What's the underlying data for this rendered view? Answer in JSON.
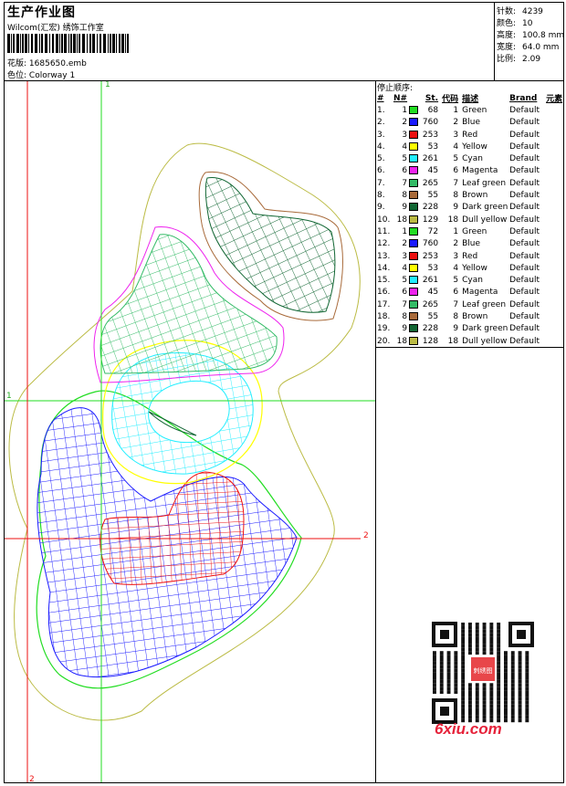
{
  "header": {
    "title": "生产作业图",
    "subtitle": "Wilcom(汇宏) 绣饰工作室",
    "file_label": "花版:",
    "file_value": "1685650.emb",
    "colorway_label": "色位:",
    "colorway_value": "Colorway 1"
  },
  "stats": [
    {
      "label": "针数:",
      "value": "4239"
    },
    {
      "label": "颜色:",
      "value": "10"
    },
    {
      "label": "高度:",
      "value": "100.8 mm"
    },
    {
      "label": "宽度:",
      "value": "64.0 mm"
    },
    {
      "label": "比例:",
      "value": "2.09"
    }
  ],
  "sequence": {
    "title": "停止顺序:",
    "columns": [
      "#",
      "N#",
      "St.",
      "代码",
      "描述",
      "Brand",
      "元素"
    ],
    "rows": [
      {
        "idx": "1.",
        "n": "1",
        "color": "#22dd22",
        "st": "68",
        "code": "1",
        "desc": "Green",
        "brand": "Default"
      },
      {
        "idx": "2.",
        "n": "2",
        "color": "#1a1aff",
        "st": "760",
        "code": "2",
        "desc": "Blue",
        "brand": "Default"
      },
      {
        "idx": "3.",
        "n": "3",
        "color": "#ee1111",
        "st": "253",
        "code": "3",
        "desc": "Red",
        "brand": "Default"
      },
      {
        "idx": "4.",
        "n": "4",
        "color": "#ffff00",
        "st": "53",
        "code": "4",
        "desc": "Yellow",
        "brand": "Default"
      },
      {
        "idx": "5.",
        "n": "5",
        "color": "#22eeff",
        "st": "261",
        "code": "5",
        "desc": "Cyan",
        "brand": "Default"
      },
      {
        "idx": "6.",
        "n": "6",
        "color": "#ee22ee",
        "st": "45",
        "code": "6",
        "desc": "Magenta",
        "brand": "Default"
      },
      {
        "idx": "7.",
        "n": "7",
        "color": "#33bb66",
        "st": "265",
        "code": "7",
        "desc": "Leaf green",
        "brand": "Default"
      },
      {
        "idx": "8.",
        "n": "8",
        "color": "#a86a3a",
        "st": "55",
        "code": "8",
        "desc": "Brown",
        "brand": "Default"
      },
      {
        "idx": "9.",
        "n": "9",
        "color": "#116633",
        "st": "228",
        "code": "9",
        "desc": "Dark green",
        "brand": "Default"
      },
      {
        "idx": "10.",
        "n": "18",
        "color": "#bbbb44",
        "st": "129",
        "code": "18",
        "desc": "Dull yellow",
        "brand": "Default"
      },
      {
        "idx": "11.",
        "n": "1",
        "color": "#22dd22",
        "st": "72",
        "code": "1",
        "desc": "Green",
        "brand": "Default"
      },
      {
        "idx": "12.",
        "n": "2",
        "color": "#1a1aff",
        "st": "760",
        "code": "2",
        "desc": "Blue",
        "brand": "Default"
      },
      {
        "idx": "13.",
        "n": "3",
        "color": "#ee1111",
        "st": "253",
        "code": "3",
        "desc": "Red",
        "brand": "Default"
      },
      {
        "idx": "14.",
        "n": "4",
        "color": "#ffff00",
        "st": "53",
        "code": "4",
        "desc": "Yellow",
        "brand": "Default"
      },
      {
        "idx": "15.",
        "n": "5",
        "color": "#22eeff",
        "st": "261",
        "code": "5",
        "desc": "Cyan",
        "brand": "Default"
      },
      {
        "idx": "16.",
        "n": "6",
        "color": "#ee22ee",
        "st": "45",
        "code": "6",
        "desc": "Magenta",
        "brand": "Default"
      },
      {
        "idx": "17.",
        "n": "7",
        "color": "#33bb66",
        "st": "265",
        "code": "7",
        "desc": "Leaf green",
        "brand": "Default"
      },
      {
        "idx": "18.",
        "n": "8",
        "color": "#a86a3a",
        "st": "55",
        "code": "8",
        "desc": "Brown",
        "brand": "Default"
      },
      {
        "idx": "19.",
        "n": "9",
        "color": "#116633",
        "st": "228",
        "code": "9",
        "desc": "Dark green",
        "brand": "Default"
      },
      {
        "idx": "20.",
        "n": "18",
        "color": "#bbbb44",
        "st": "128",
        "code": "18",
        "desc": "Dull yellow",
        "brand": "Default"
      }
    ]
  },
  "axis_labels": {
    "top": "1",
    "left": "1",
    "right": "2",
    "bottom": "2"
  },
  "watermark": "6xiu.com",
  "qr_badge": "刺绣图"
}
